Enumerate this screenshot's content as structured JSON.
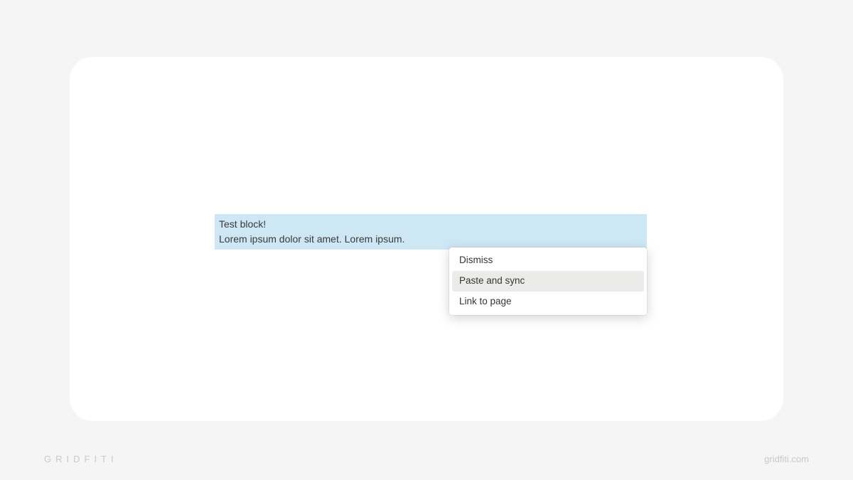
{
  "block": {
    "line1": "Test block!",
    "line2": "Lorem ipsum dolor sit amet. Lorem ipsum."
  },
  "menu": {
    "items": [
      {
        "label": "Dismiss",
        "highlighted": false
      },
      {
        "label": "Paste and sync",
        "highlighted": true
      },
      {
        "label": "Link to page",
        "highlighted": false
      }
    ]
  },
  "watermark": {
    "left": "GRIDFITI",
    "right": "gridfiti.com"
  }
}
